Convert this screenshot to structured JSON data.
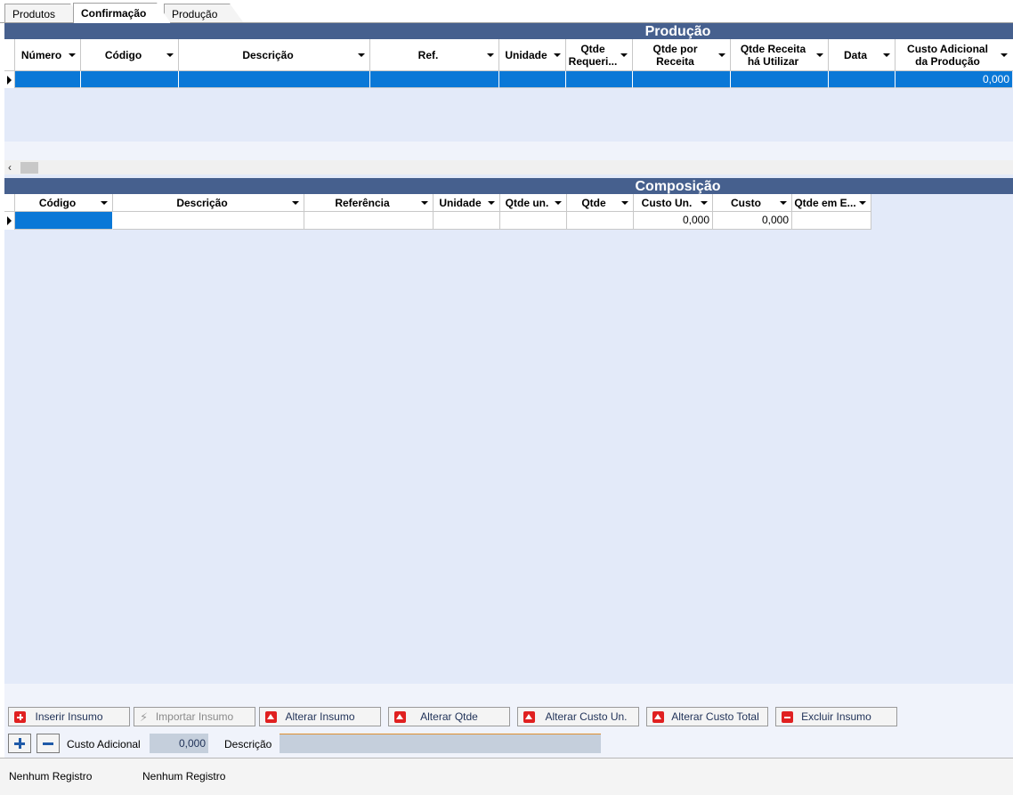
{
  "tabs": [
    {
      "label": "Produtos"
    },
    {
      "label": "Confirmação"
    },
    {
      "label": "Produção"
    }
  ],
  "producao": {
    "title": "Produção",
    "columns": [
      "Número",
      "Código",
      "Descrição",
      "Ref.",
      "Unidade",
      "Qtde Requeri...",
      "Qtde por Receita",
      "Qtde Receita há Utilizar",
      "Data",
      "Custo Adicional da Produção"
    ],
    "row_custo": "0,000"
  },
  "composicao": {
    "title": "Composição",
    "columns": [
      "Código",
      "Descrição",
      "Referência",
      "Unidade",
      "Qtde un.",
      "Qtde",
      "Custo Un.",
      "Custo",
      "Qtde em E..."
    ],
    "row_custo_un": "0,000",
    "row_custo": "0,000"
  },
  "buttons": {
    "inserir": "Inserir Insumo",
    "importar": "Importar Insumo",
    "alterar_insumo": "Alterar Insumo",
    "alterar_qtde": "Alterar Qtde",
    "alterar_custo_un": "Alterar Custo Un.",
    "alterar_custo_total": "Alterar Custo Total",
    "excluir": "Excluir Insumo"
  },
  "footer_form": {
    "custo_adicional_label": "Custo Adicional",
    "custo_adicional_value": "0,000",
    "descricao_label": "Descrição",
    "descricao_value": ""
  },
  "status": {
    "left": "Nenhum Registro",
    "right": "Nenhum Registro"
  }
}
